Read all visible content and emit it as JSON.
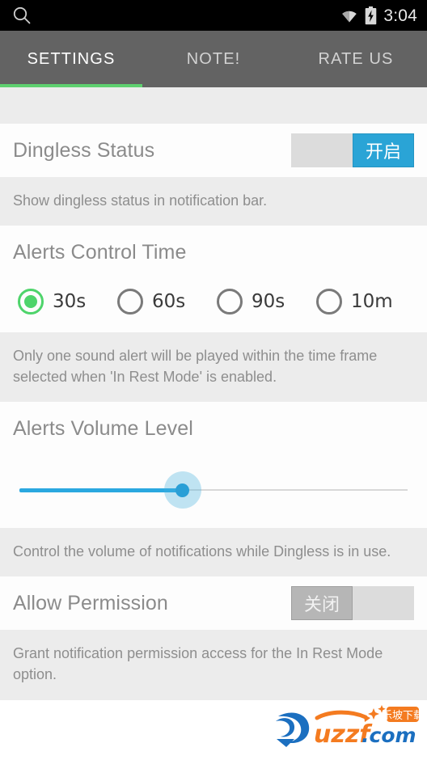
{
  "status_bar": {
    "search_icon": "search-icon",
    "wifi_icon": "wifi-icon",
    "battery_icon": "battery-charging-icon",
    "time": "3:04"
  },
  "tabs": [
    {
      "label": "SETTINGS",
      "active": true
    },
    {
      "label": "NOTE!",
      "active": false
    },
    {
      "label": "RATE US",
      "active": false
    }
  ],
  "settings": {
    "dingless_status": {
      "title": "Dingless Status",
      "description": "Show dingless status in notification bar.",
      "toggle_state": "on",
      "toggle_on_label": "开启",
      "toggle_off_label": "关闭"
    },
    "alerts_control_time": {
      "title": "Alerts Control Time",
      "description": "Only one sound alert will be played within the time frame selected when 'In Rest Mode' is enabled.",
      "options": [
        {
          "label": "30s",
          "selected": true
        },
        {
          "label": "60s",
          "selected": false
        },
        {
          "label": "90s",
          "selected": false
        },
        {
          "label": "10m",
          "selected": false
        }
      ]
    },
    "alerts_volume_level": {
      "title": "Alerts Volume Level",
      "description": "Control the volume of notifications while Dingless is in use.",
      "value_percent": 42
    },
    "allow_permission": {
      "title": "Allow Permission",
      "description": "Grant notification permission access for the In Rest Mode option.",
      "toggle_state": "off",
      "toggle_off_label": "关闭"
    }
  },
  "watermark": {
    "brand": "uzzf",
    "domain": ".com",
    "chinese": "乐坡下载",
    "accent_orange": "#f47b20",
    "accent_blue": "#1b6fc0"
  },
  "colors": {
    "status_bar_bg": "#000000",
    "tab_bar_bg": "#636363",
    "tab_indicator": "#5ed06f",
    "band_bg": "#ececec",
    "row_bg": "#fdfdfd",
    "title_text": "#8b8b8b",
    "desc_text": "#8e8e8e",
    "switch_on": "#2aa4d6",
    "switch_off": "#b6b6b6",
    "radio_selected": "#4ed46b",
    "slider_accent": "#2aa8e0"
  }
}
